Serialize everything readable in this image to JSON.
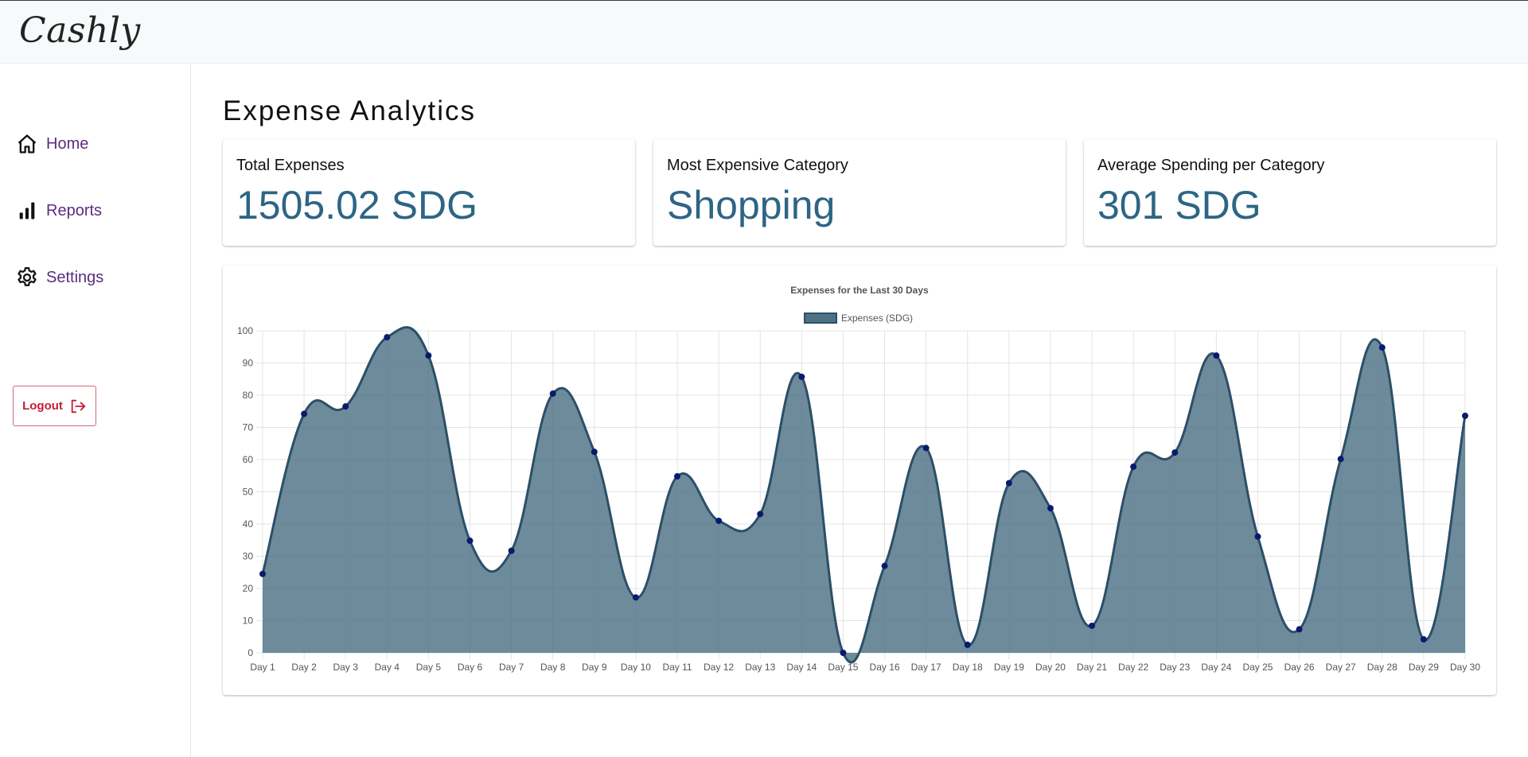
{
  "app": {
    "logo": "Cashly"
  },
  "sidebar": {
    "items": [
      {
        "label": "Home",
        "icon": "home-icon"
      },
      {
        "label": "Reports",
        "icon": "bar-chart-icon"
      },
      {
        "label": "Settings",
        "icon": "gear-icon"
      }
    ],
    "logout_label": "Logout",
    "logout_icon": "logout-icon"
  },
  "main": {
    "title": "Expense Analytics",
    "cards": [
      {
        "label": "Total Expenses",
        "value": "1505.02 SDG"
      },
      {
        "label": "Most Expensive Category",
        "value": "Shopping"
      },
      {
        "label": "Average Spending per Category",
        "value": "301 SDG"
      }
    ]
  },
  "colors": {
    "accent": "#2d6585",
    "nav_text": "#5b2d82",
    "logout": "#c41e3a",
    "chart_line": "#2c4f68",
    "chart_fill": "#4d7185",
    "chart_point": "#0a1a6e"
  },
  "chart_data": {
    "type": "area",
    "title": "Expenses for the Last 30 Days",
    "xlabel": "",
    "ylabel": "",
    "ylim": [
      0,
      100
    ],
    "yticks": [
      0,
      10,
      20,
      30,
      40,
      50,
      60,
      70,
      80,
      90,
      100
    ],
    "grid": true,
    "legend_position": "top",
    "categories": [
      "Day 1",
      "Day 2",
      "Day 3",
      "Day 4",
      "Day 5",
      "Day 6",
      "Day 7",
      "Day 8",
      "Day 9",
      "Day 10",
      "Day 11",
      "Day 12",
      "Day 13",
      "Day 14",
      "Day 15",
      "Day 16",
      "Day 17",
      "Day 18",
      "Day 19",
      "Day 20",
      "Day 21",
      "Day 22",
      "Day 23",
      "Day 24",
      "Day 25",
      "Day 26",
      "Day 27",
      "Day 28",
      "Day 29",
      "Day 30"
    ],
    "series": [
      {
        "name": "Expenses (SDG)",
        "values": [
          24.5,
          74.2,
          76.5,
          98.0,
          92.3,
          34.8,
          31.7,
          80.5,
          62.4,
          17.2,
          54.8,
          41.0,
          43.1,
          85.7,
          0.0,
          27.0,
          63.6,
          2.5,
          52.7,
          44.9,
          8.4,
          57.8,
          62.2,
          92.3,
          36.1,
          7.3,
          60.2,
          94.8,
          4.2,
          73.6
        ]
      }
    ]
  }
}
